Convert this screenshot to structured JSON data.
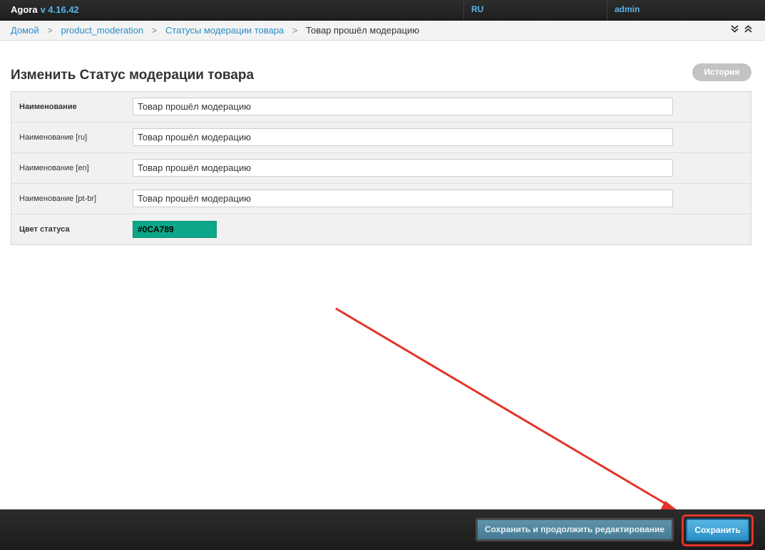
{
  "header": {
    "brand": "Agora",
    "version": "v 4.16.42",
    "language": "RU",
    "user": "admin"
  },
  "breadcrumb": {
    "items": [
      "Домой",
      "product_moderation",
      "Статусы модерации товара"
    ],
    "current": "Товар прошёл модерацию",
    "separator": ">"
  },
  "page": {
    "title": "Изменить Статус модерации товара",
    "history_label": "История"
  },
  "form": {
    "fields": [
      {
        "label": "Наименование",
        "value": "Товар прошёл модерацию"
      },
      {
        "label": "Наименование [ru]",
        "value": "Товар прошёл модерацию"
      },
      {
        "label": "Наименование [en]",
        "value": "Товар прошёл модерацию"
      },
      {
        "label": "Наименование [pt-br]",
        "value": "Товар прошёл модерацию"
      }
    ],
    "color": {
      "label": "Цвет статуса",
      "value": "#0CA789"
    }
  },
  "footer": {
    "save_continue_label": "Сохранить и продолжить редактирование",
    "save_label": "Сохранить"
  },
  "icons": {
    "collapse_down": "double-chevron-down-icon",
    "collapse_up": "double-chevron-up-icon",
    "crumb_sep": "chevron-right-icon"
  },
  "colors": {
    "accent": "#2a8dc5",
    "status_color": "#0CA789",
    "annotation": "#e3342a"
  }
}
